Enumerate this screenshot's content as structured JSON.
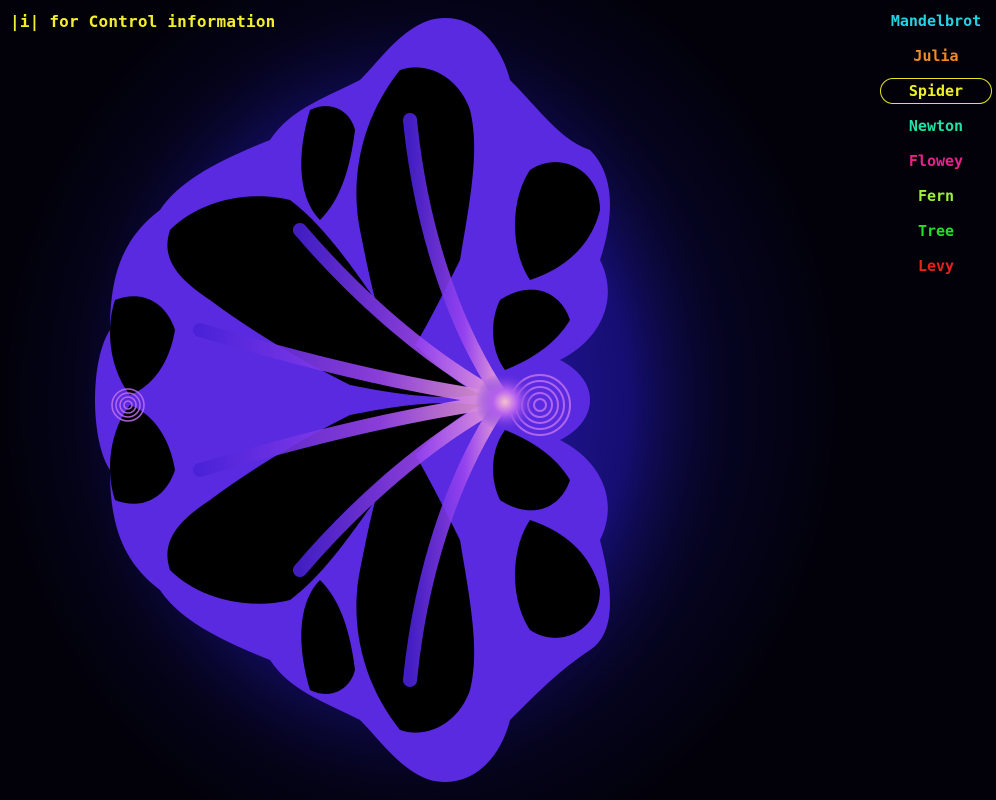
{
  "hint": {
    "text": "|i| for Control information",
    "color": "#f2ef2a"
  },
  "menu": {
    "selected": "Spider",
    "items": [
      {
        "label": "Mandelbrot",
        "color": "#22d3e6"
      },
      {
        "label": "Julia",
        "color": "#f08a24"
      },
      {
        "label": "Spider",
        "color": "#eef02a"
      },
      {
        "label": "Newton",
        "color": "#22e0a6"
      },
      {
        "label": "Flowey",
        "color": "#e8208e"
      },
      {
        "label": "Fern",
        "color": "#9ef03a"
      },
      {
        "label": "Tree",
        "color": "#22e02a"
      },
      {
        "label": "Levy",
        "color": "#e8201e"
      }
    ]
  },
  "fractal": {
    "name": "Spider",
    "colors": {
      "background": "#05041f",
      "halo": "#2a1aa0",
      "stripe": "#7a3df0",
      "stripe_hot": "#f0a0e0",
      "interior": "#000000"
    }
  }
}
